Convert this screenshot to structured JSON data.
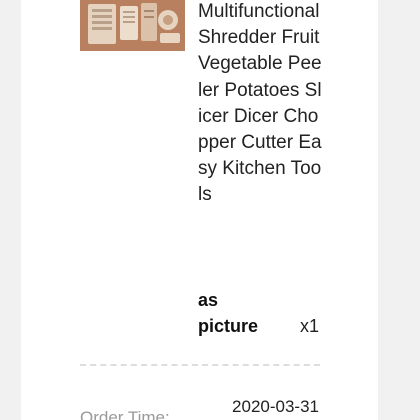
{
  "product": {
    "title": "Multifunctional Shredder Fruit Vegetable Peeler Potatoes Slicer Dicer Chopper Cutter Easy Kitchen Tools",
    "variant": "as picture",
    "quantity": "x1",
    "image_subject": "kitchen-tools-product-image"
  },
  "order": {
    "time_label": "Order Time:",
    "time_value": "2020-03-31"
  }
}
